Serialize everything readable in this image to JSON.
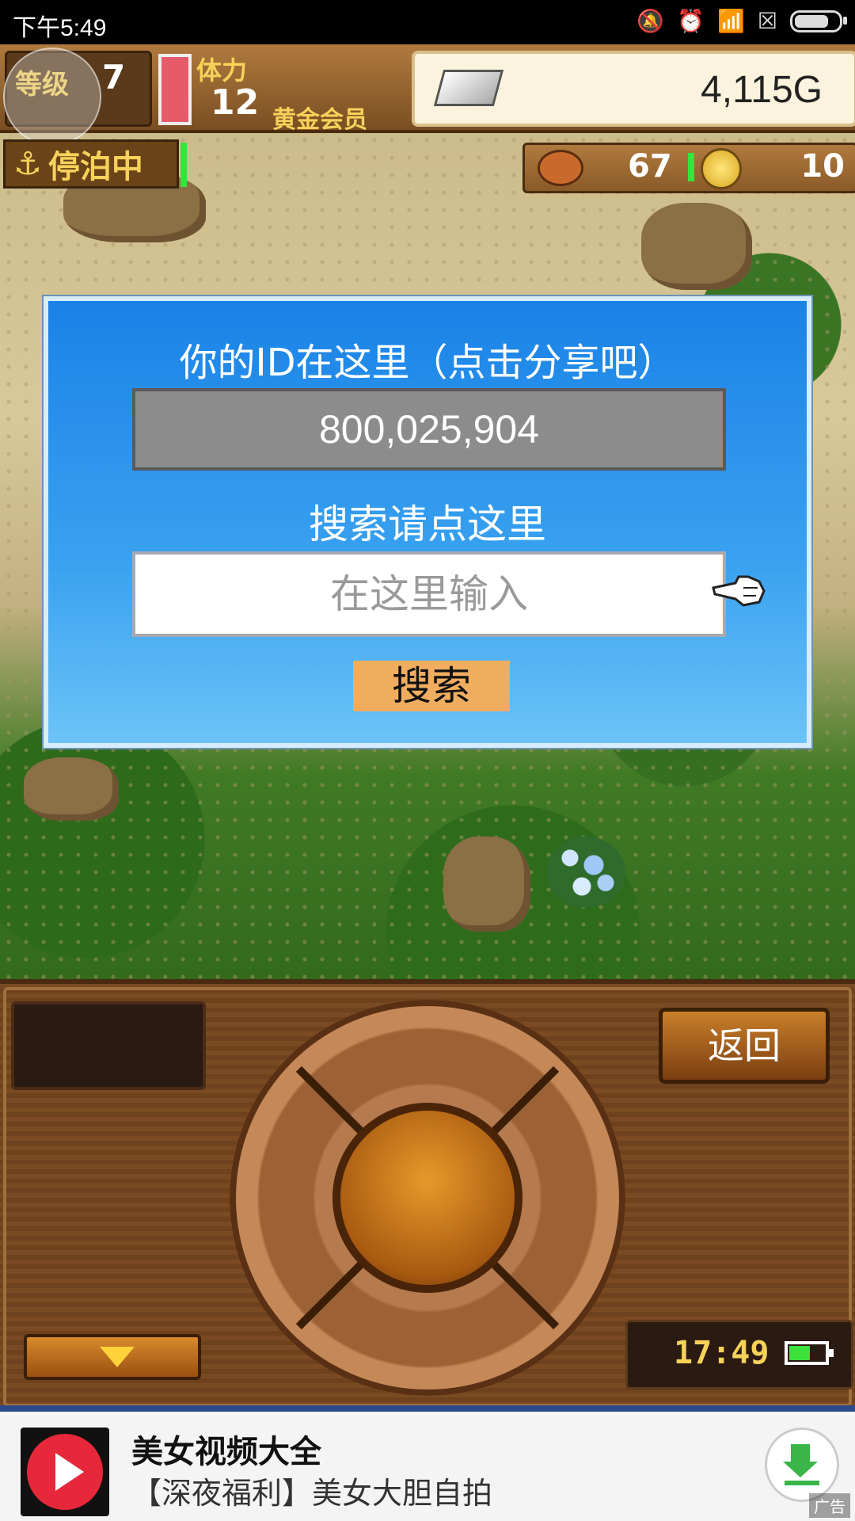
{
  "status_bar": {
    "time": "下午5:49",
    "icons": [
      "mute-icon",
      "alarm-icon",
      "wifi-icon",
      "no-sim-icon",
      "battery-icon"
    ]
  },
  "hud": {
    "level_label": "等级",
    "level_value": "7",
    "stamina_label": "体力",
    "stamina_value": "12",
    "member_label": "黄金会员",
    "gold": "4,115G",
    "dock_status": "停泊中",
    "food_value": "67",
    "coin_value": "10"
  },
  "dialog": {
    "title": "你的ID在这里（点击分享吧）",
    "player_id": "800,025,904",
    "search_title": "搜索请点这里",
    "search_placeholder": "在这里输入",
    "search_button": "搜索"
  },
  "panel": {
    "back_button": "返回",
    "clock": "17:49"
  },
  "ad": {
    "title": "美女视频大全",
    "subtitle": "【深夜福利】美女大胆自拍",
    "tag": "广告"
  },
  "colors": {
    "dialog_top": "#1a82e6",
    "dialog_bottom": "#6cc3f7",
    "search_button": "#f0ad60",
    "id_box": "#8c8c8c"
  }
}
